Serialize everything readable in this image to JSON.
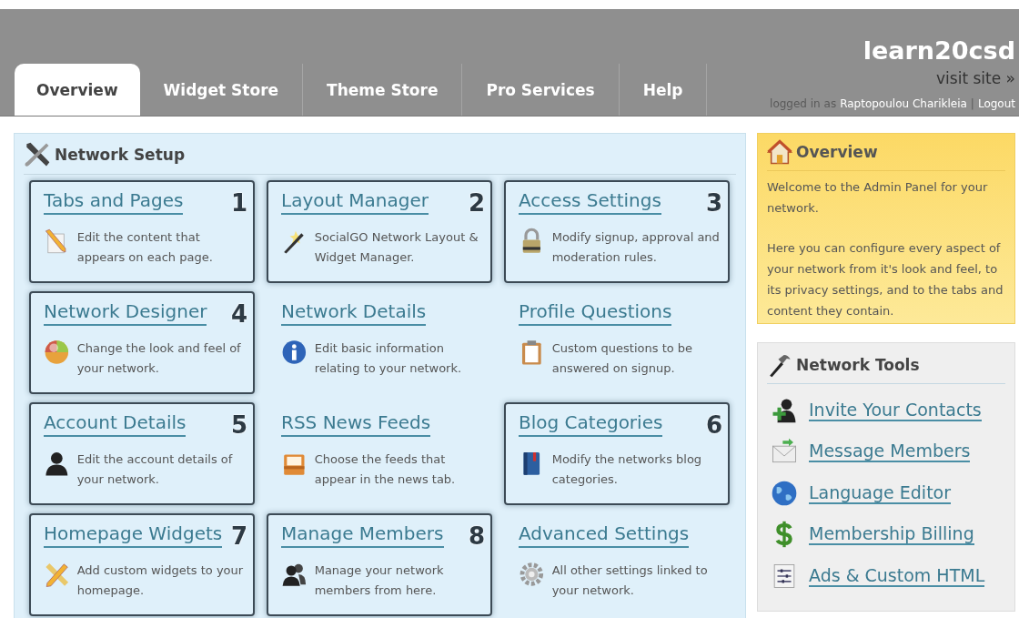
{
  "header": {
    "site_name": "learn20csd",
    "visit_link": "visit site »",
    "login_prefix": "logged in as",
    "user_name": "Raptopoulou Charikleia",
    "separator": "|",
    "logout": "Logout"
  },
  "tabs": [
    {
      "label": "Overview",
      "selected": true
    },
    {
      "label": "Widget Store",
      "selected": false
    },
    {
      "label": "Theme Store",
      "selected": false
    },
    {
      "label": "Pro Services",
      "selected": false
    },
    {
      "label": "Help",
      "selected": false
    }
  ],
  "network_setup": {
    "title": "Network Setup",
    "cards": [
      {
        "title": "Tabs and Pages",
        "number": "1",
        "kind": "pencil",
        "description": "Edit the content that appears on each page."
      },
      {
        "title": "Layout Manager",
        "number": "2",
        "kind": "wand",
        "description": "SocialGO Network Layout & Widget Manager."
      },
      {
        "title": "Access Settings",
        "number": "3",
        "kind": "lock",
        "description": "Modify signup, approval and moderation rules."
      },
      {
        "title": "Network Designer",
        "number": "4",
        "kind": "ball",
        "description": "Change the look and feel of your network."
      },
      {
        "title": "Network Details",
        "kind": "info",
        "description": "Edit basic information relating to your network."
      },
      {
        "title": "Profile Questions",
        "kind": "clipboard",
        "description": "Custom questions to be answered on signup."
      },
      {
        "title": "Account Details",
        "number": "5",
        "kind": "person",
        "description": "Edit the account details of your network."
      },
      {
        "title": "RSS News Feeds",
        "kind": "tray",
        "description": "Choose the feeds that appear in the news tab."
      },
      {
        "title": "Blog Categories",
        "number": "6",
        "kind": "book",
        "description": "Modify the networks blog categories."
      },
      {
        "title": "Homepage Widgets",
        "number": "7",
        "kind": "pencil-ruler",
        "description": "Add custom widgets to your homepage."
      },
      {
        "title": "Manage Members",
        "number": "8",
        "kind": "people",
        "description": "Manage your network members from here."
      },
      {
        "title": "Advanced Settings",
        "kind": "gear",
        "description": "All other settings linked to your network."
      }
    ]
  },
  "overview": {
    "title": "Overview",
    "paragraphs": [
      "Welcome to the Admin Panel for your network.",
      "Here you can configure every aspect of your network from it's look and feel, to its privacy settings, and to the tabs and content they contain."
    ]
  },
  "network_tools": {
    "title": "Network Tools",
    "items": [
      {
        "label": "Invite Your Contacts",
        "kind": "add-user"
      },
      {
        "label": "Message Members",
        "kind": "mail"
      },
      {
        "label": "Language Editor",
        "kind": "globe"
      },
      {
        "label": "Membership Billing",
        "kind": "dollar"
      },
      {
        "label": "Ads & Custom HTML",
        "kind": "sliders"
      }
    ]
  }
}
